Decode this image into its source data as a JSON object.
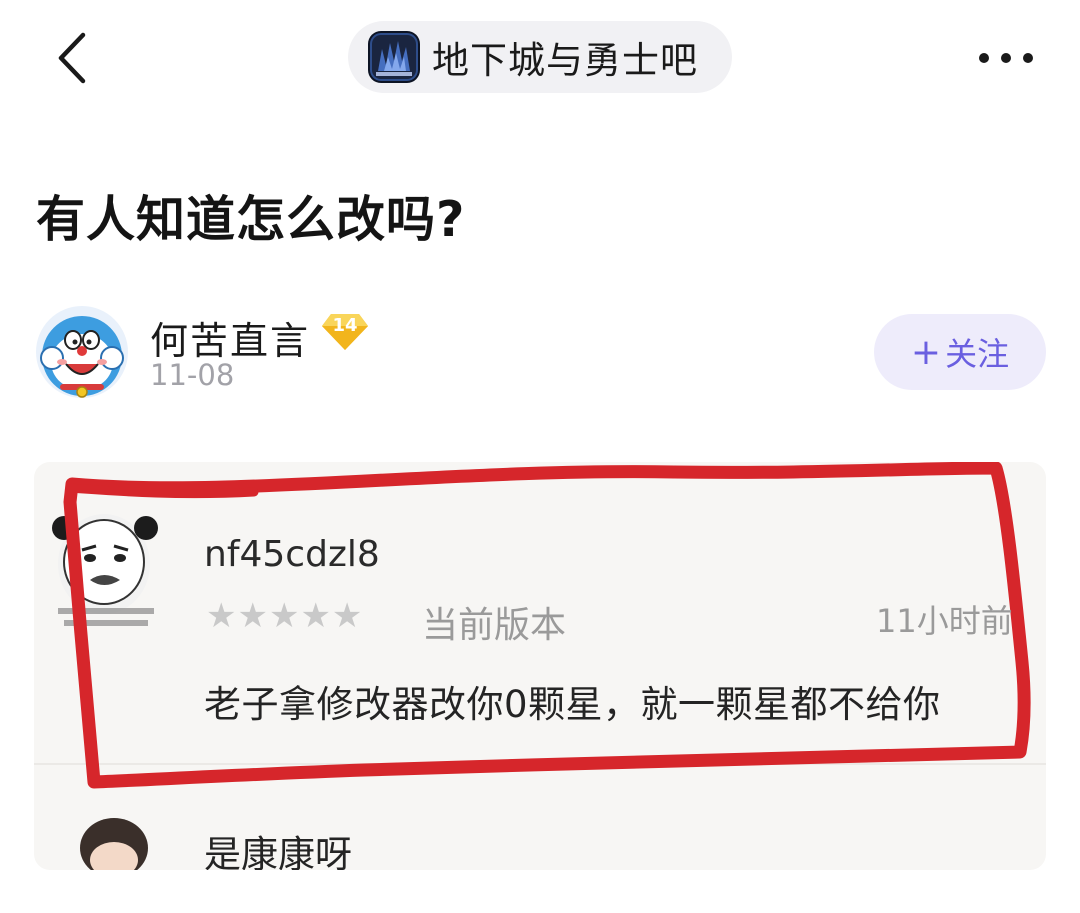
{
  "nav": {
    "back_icon": "chevron-left-icon",
    "forum_name": "地下城与勇士吧",
    "forum_avatar_icon": "forum-logo",
    "more_icon": "more-dots-icon"
  },
  "post": {
    "title": "有人知道怎么改吗?",
    "author": {
      "name": "何苦直言",
      "level": "14",
      "date": "11-08",
      "avatar_icon": "cartoon-avatar"
    },
    "follow": {
      "plus": "+",
      "label": "关注"
    }
  },
  "image": {
    "review": {
      "username": "nf45cdzl8",
      "stars": "★★★★★",
      "rating": 0,
      "version": "当前版本",
      "time": "11小时前",
      "comment": "老子拿修改器改你0颗星，就一颗星都不给你"
    },
    "next_review": {
      "username": "是康康呀"
    }
  },
  "colors": {
    "accent": "#6a5fe0",
    "follow_bg": "#eeecfb",
    "pill_bg": "#f1f1f4",
    "badge": "#f7c52f",
    "highlight": "#d6262b",
    "muted": "#a2a2a8"
  }
}
